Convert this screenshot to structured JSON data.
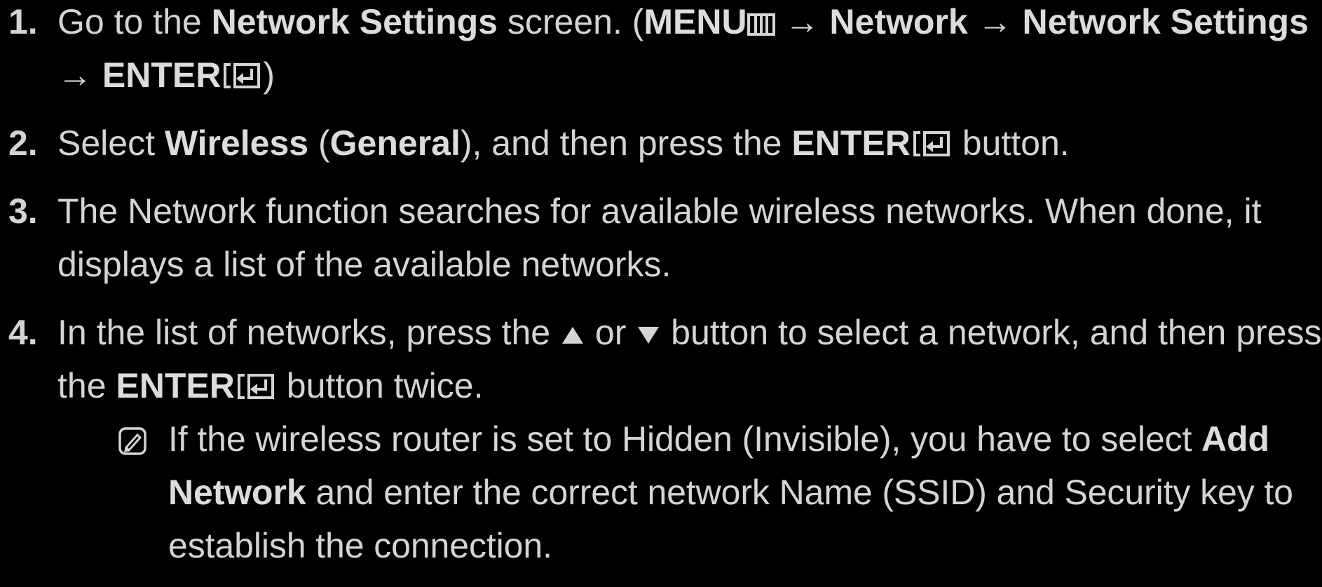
{
  "steps": [
    {
      "number": "1.",
      "t1": "Go to the ",
      "b1": "Network Settings",
      "t2": " screen. (",
      "b2": "MENU",
      "t3": " → ",
      "b3": "Network",
      "t4": " → ",
      "b4": "Network Settings",
      "t5": " → ",
      "b5": "ENTER",
      "t6": ")"
    },
    {
      "number": "2.",
      "t1": "Select ",
      "b1": "Wireless",
      "t2": " (",
      "b2": "General",
      "t3": "), and then press the ",
      "b3": "ENTER",
      "t4": " button."
    },
    {
      "number": "3.",
      "text": "The Network function searches for available wireless networks. When done, it displays a list of the available networks."
    },
    {
      "number": "4.",
      "t1": "In the list of networks, press the ",
      "t2": " or ",
      "t3": " button to select a network, and then press the ",
      "b1": "ENTER",
      "t4": " button twice."
    }
  ],
  "note": {
    "icon": "note-icon",
    "t1": "If the wireless router is set to Hidden (Invisible), you have to select ",
    "b1": "Add Network",
    "t2": " and enter the correct network Name (SSID) and Security key to establish the connection."
  },
  "icons": {
    "menu": "menu-icon",
    "enter": "enter-icon",
    "up": "up-triangle-icon",
    "down": "down-triangle-icon"
  },
  "colors": {
    "background": "#000000",
    "text": "#d4d4d4"
  }
}
